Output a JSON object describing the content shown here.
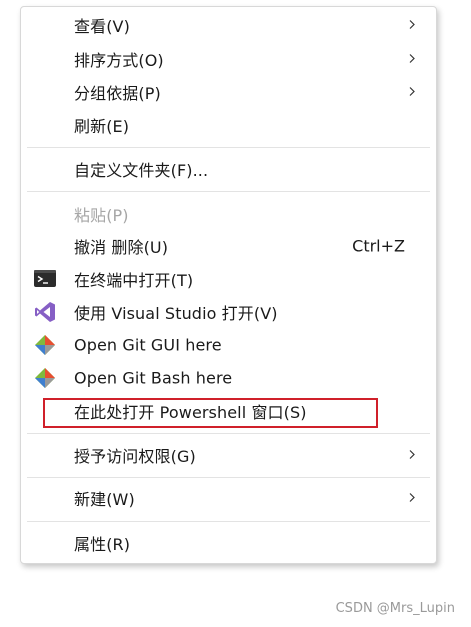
{
  "menu": {
    "items": [
      {
        "label": "查看(V)",
        "submenu": true
      },
      {
        "label": "排序方式(O)",
        "submenu": true
      },
      {
        "label": "分组依据(P)",
        "submenu": true
      },
      {
        "label": "刷新(E)"
      },
      {
        "label": "自定义文件夹(F)..."
      },
      {
        "label": "粘贴(P)",
        "disabled": true
      },
      {
        "label": "撤消 删除(U)",
        "shortcut": "Ctrl+Z"
      },
      {
        "label": "在终端中打开(T)",
        "icon": "terminal-icon"
      },
      {
        "label": "使用 Visual Studio 打开(V)",
        "icon": "visual-studio-icon"
      },
      {
        "label": "Open Git GUI here",
        "icon": "git-icon"
      },
      {
        "label": "Open Git Bash here",
        "icon": "git-icon"
      },
      {
        "label": "在此处打开 Powershell 窗口(S)"
      },
      {
        "label": "授予访问权限(G)",
        "submenu": true
      },
      {
        "label": "新建(W)",
        "submenu": true
      },
      {
        "label": "属性(R)"
      }
    ]
  },
  "colors": {
    "highlight": "#d0202a",
    "disabled_text": "#a6a6a6",
    "vs_purple": "#865fc5",
    "git_red": "#e84e31"
  },
  "watermark": "CSDN @Mrs_Lupin"
}
